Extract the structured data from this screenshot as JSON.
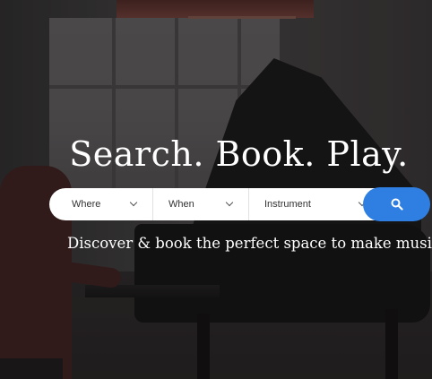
{
  "hero": {
    "headline": "Search. Book. Play.",
    "tagline": "Discover & book the perfect space to make music"
  },
  "search": {
    "where_label": "Where",
    "when_label": "When",
    "instrument_label": "Instrument",
    "button_icon": "search-icon"
  },
  "colors": {
    "accent": "#2f7fe3",
    "bar_background": "#ffffff",
    "text_light": "#ffffff"
  }
}
